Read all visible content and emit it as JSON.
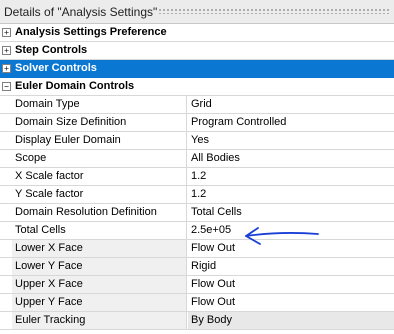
{
  "window": {
    "title": "Details of \"Analysis Settings\""
  },
  "categories": [
    {
      "label": "Analysis Settings Preference",
      "expander": "+",
      "selected": false
    },
    {
      "label": "Step Controls",
      "expander": "+",
      "selected": false
    },
    {
      "label": "Solver Controls",
      "expander": "+",
      "selected": true
    },
    {
      "label": "Euler Domain Controls",
      "expander": "−",
      "selected": false
    }
  ],
  "properties": [
    {
      "name": "Domain Type",
      "value": "Grid"
    },
    {
      "name": "Domain Size Definition",
      "value": "Program Controlled"
    },
    {
      "name": "Display Euler Domain",
      "value": "Yes"
    },
    {
      "name": "Scope",
      "value": "All Bodies"
    },
    {
      "name": "X Scale factor",
      "value": "1.2"
    },
    {
      "name": "Y Scale factor",
      "value": "1.2"
    },
    {
      "name": "Domain Resolution Definition",
      "value": "Total Cells"
    },
    {
      "name": "Total Cells",
      "value": "2.5e+05"
    },
    {
      "name": "Lower X Face",
      "value": "Flow Out"
    },
    {
      "name": "Lower Y Face",
      "value": "Rigid"
    },
    {
      "name": "Upper X Face",
      "value": "Flow Out"
    },
    {
      "name": "Upper Y Face",
      "value": "Flow Out"
    },
    {
      "name": "Euler Tracking",
      "value": "By Body"
    }
  ],
  "colors": {
    "selected": "#0a78d2",
    "annotation": "#1a3fd6"
  }
}
